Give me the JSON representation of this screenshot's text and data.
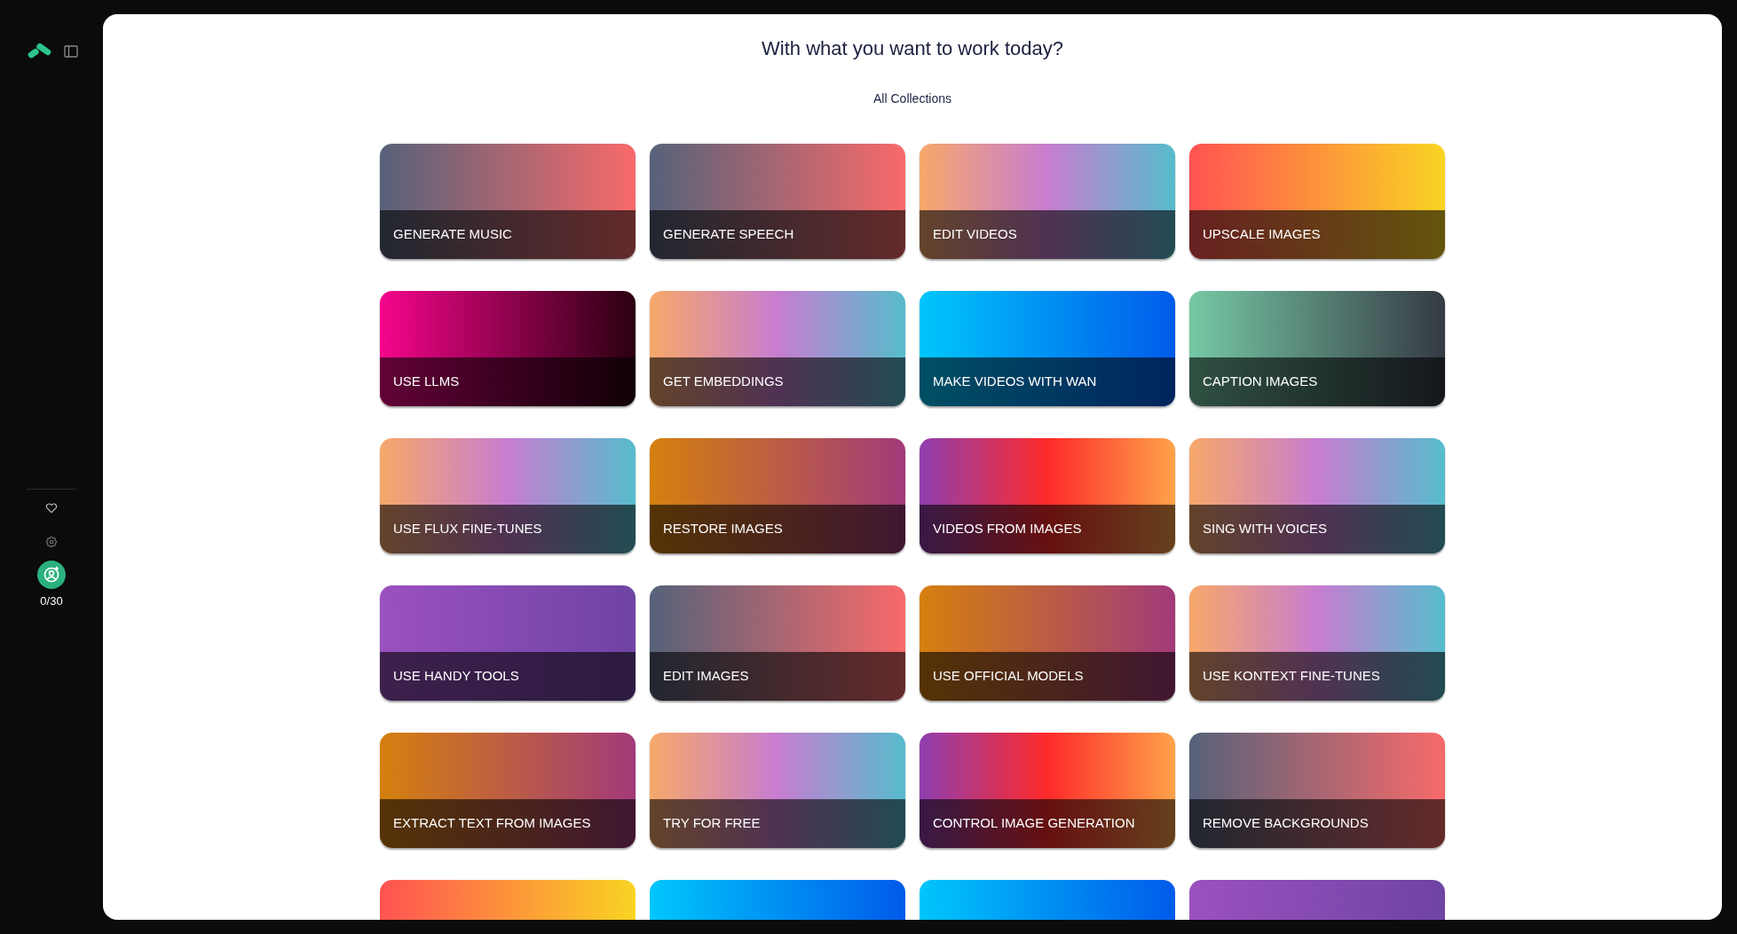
{
  "sidebar": {
    "usage": "0/30"
  },
  "heading": "With what you want to work today?",
  "filter": "All Collections",
  "collections": [
    {
      "label": "GENERATE MUSIC",
      "kind": "slate"
    },
    {
      "label": "GENERATE SPEECH",
      "kind": "slate"
    },
    {
      "label": "EDIT VIDEOS",
      "kind": "rainbow"
    },
    {
      "label": "UPSCALE IMAGES",
      "kind": "sunset"
    },
    {
      "label": "USE LLMS",
      "kind": "magenta"
    },
    {
      "label": "GET EMBEDDINGS",
      "kind": "rainbow"
    },
    {
      "label": "MAKE VIDEOS WITH WAN",
      "kind": "ocean"
    },
    {
      "label": "CAPTION IMAGES",
      "kind": "mint"
    },
    {
      "label": "USE FLUX FINE-TUNES",
      "kind": "rainbow"
    },
    {
      "label": "RESTORE IMAGES",
      "kind": "amber"
    },
    {
      "label": "VIDEOS FROM IMAGES",
      "kind": "fire"
    },
    {
      "label": "SING WITH VOICES",
      "kind": "rainbow"
    },
    {
      "label": "USE HANDY TOOLS",
      "kind": "violet"
    },
    {
      "label": "EDIT IMAGES",
      "kind": "slate"
    },
    {
      "label": "USE OFFICIAL MODELS",
      "kind": "amber"
    },
    {
      "label": "USE KONTEXT FINE-TUNES",
      "kind": "rainbow"
    },
    {
      "label": "EXTRACT TEXT FROM IMAGES",
      "kind": "amber"
    },
    {
      "label": "TRY FOR FREE",
      "kind": "rainbow"
    },
    {
      "label": "CONTROL IMAGE GENERATION",
      "kind": "fire"
    },
    {
      "label": "REMOVE BACKGROUNDS",
      "kind": "slate"
    }
  ],
  "partial_row": [
    {
      "kind": "sunset"
    },
    {
      "kind": "ocean"
    },
    {
      "kind": "ocean"
    },
    {
      "kind": "violet"
    }
  ]
}
